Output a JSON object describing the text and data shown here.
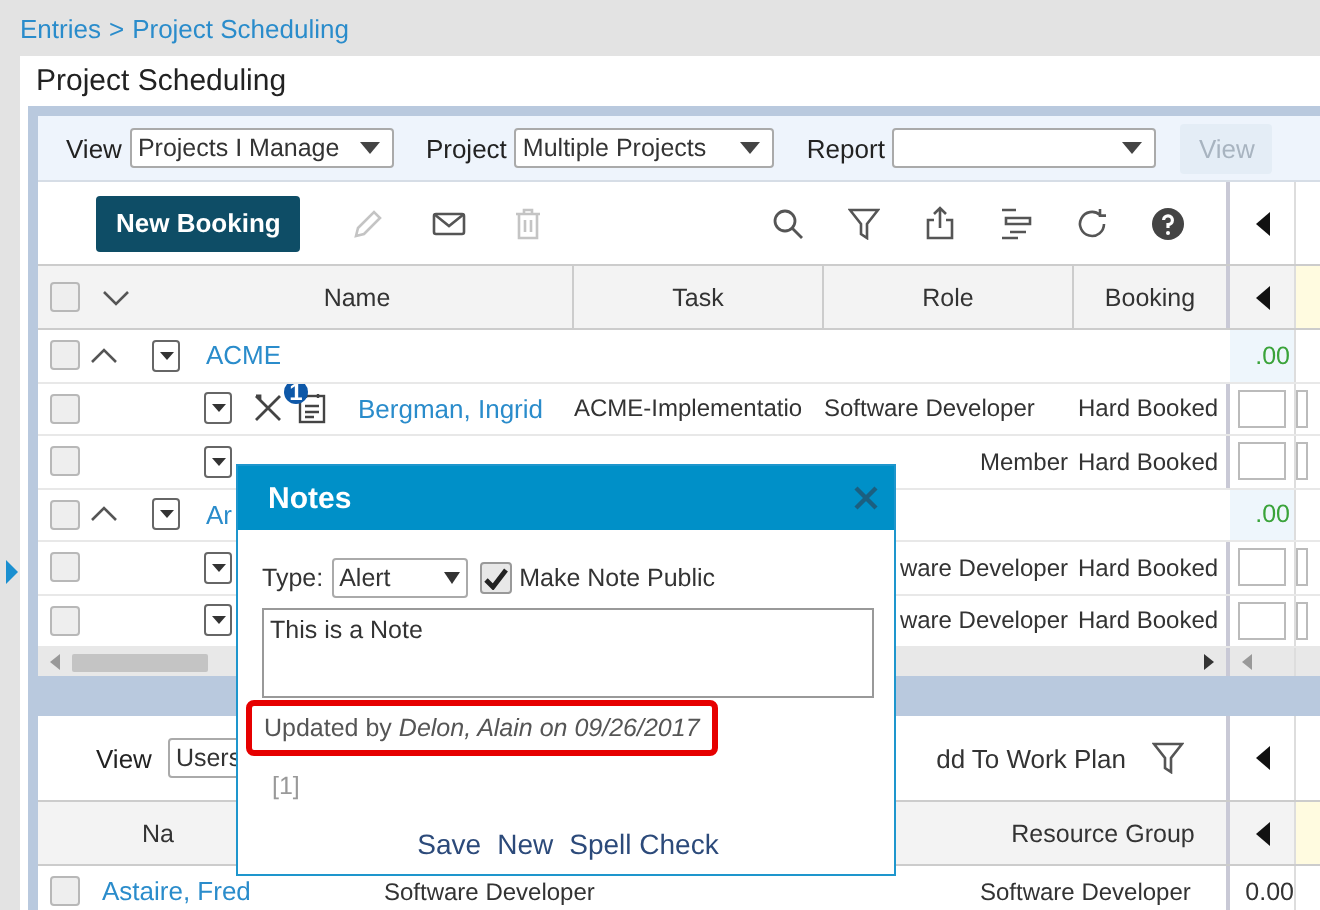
{
  "breadcrumb": {
    "items": [
      "Entries",
      "Project Scheduling"
    ],
    "separator": ">"
  },
  "page_title": "Project Scheduling",
  "filters": [
    {
      "label": "View",
      "value": "Projects I Manage"
    },
    {
      "label": "Project",
      "value": "Multiple Projects"
    },
    {
      "label": "Report"
    }
  ],
  "view_button": {
    "label": "View",
    "disabled": true
  },
  "new_booking_button": "New Booking",
  "actions": [
    {
      "kind": "edit",
      "disabled": true
    },
    {
      "kind": "mail",
      "disabled": false
    },
    {
      "kind": "delete",
      "disabled": true
    }
  ],
  "tools": [
    {
      "kind": "search"
    },
    {
      "kind": "filter"
    },
    {
      "kind": "export"
    },
    {
      "kind": "gantt"
    },
    {
      "kind": "refresh"
    },
    {
      "kind": "help"
    }
  ],
  "table": {
    "all_checked": false,
    "columns": [
      "Name",
      "Task",
      "Role",
      "Booking"
    ],
    "rows": [
      {
        "kind": "group",
        "checked": false,
        "expanded": true,
        "name": "ACME",
        "total": ".00"
      },
      {
        "kind": "booking",
        "checked": false,
        "name": "Bergman, Ingrid",
        "note_count": "1",
        "task": "ACME-Implementatio",
        "role": "Software Developer",
        "booking": "Hard Booked"
      },
      {
        "kind": "booking",
        "checked": false,
        "role": "Member",
        "booking": "Hard Booked"
      },
      {
        "kind": "group",
        "checked": false,
        "expanded": true,
        "name": "Ar",
        "total": ".00"
      },
      {
        "kind": "booking",
        "checked": false,
        "role": "ware Developer",
        "booking": "Hard Booked"
      },
      {
        "kind": "booking",
        "checked": false,
        "role": "ware Developer",
        "booking": "Hard Booked"
      }
    ]
  },
  "bottom": {
    "view_label": "View",
    "view_value": "Users",
    "add_link": "dd To Work Plan",
    "columns": [
      "Na",
      "Resource Group"
    ],
    "rows": [
      {
        "checked": false,
        "name": "Astaire, Fred",
        "role": "Software Developer",
        "resource_group": "Software Developer",
        "total": "0.00"
      }
    ]
  },
  "notes_dialog": {
    "title": "Notes",
    "type_label": "Type:",
    "type_value": "Alert",
    "public_label": "Make Note Public",
    "public_checked": true,
    "note": "This is a Note",
    "updated": "Updated by *Delon, Alain on 09/26/2017*",
    "highlighted": true,
    "page_link": "[1]",
    "actions": [
      "Save",
      "New",
      "Spell Check"
    ]
  }
}
